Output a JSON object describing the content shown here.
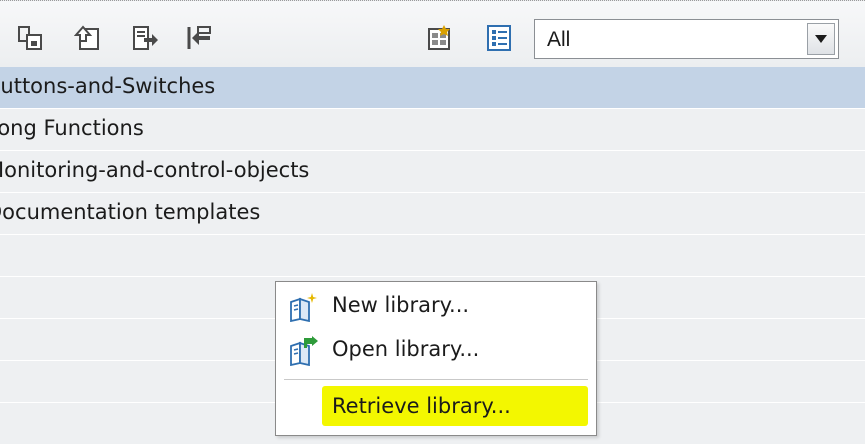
{
  "toolbar": {
    "buttons": [
      {
        "icon": "copy-library-icon"
      },
      {
        "icon": "upload-library-icon"
      },
      {
        "icon": "export-icon"
      },
      {
        "icon": "import-icon"
      },
      {
        "icon": "library-view-icon"
      },
      {
        "icon": "details-view-icon"
      }
    ],
    "filter": {
      "value": "All"
    }
  },
  "library_list": {
    "items": [
      {
        "label": "Buttons-and-Switches",
        "selected": true
      },
      {
        "label": "Long Functions",
        "selected": false
      },
      {
        "label": "Monitoring-and-control-objects",
        "selected": false
      },
      {
        "label": "Documentation templates",
        "selected": false
      }
    ]
  },
  "context_menu": {
    "items": [
      {
        "label": "New library...",
        "icon": "new-library-icon"
      },
      {
        "label": "Open library...",
        "icon": "open-library-icon"
      },
      {
        "label": "Retrieve library...",
        "icon": "",
        "highlighted": true,
        "highlight_color": "#f3f700"
      }
    ]
  },
  "colors": {
    "selected_row": "#c3d3e6",
    "background": "#eef0f2",
    "highlight": "#f3f700"
  }
}
